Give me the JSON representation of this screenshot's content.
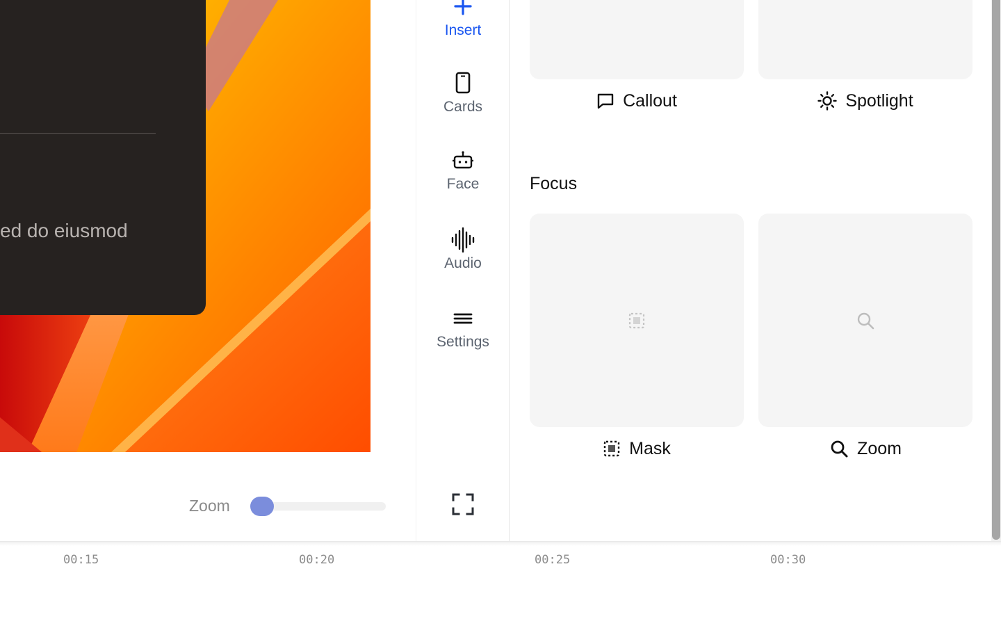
{
  "preview": {
    "card_text": "ed do eiusmod",
    "zoom_label": "Zoom",
    "zoom_level": 0
  },
  "rail": {
    "items": [
      {
        "label": "Insert",
        "icon": "plus-icon",
        "active": true
      },
      {
        "label": "Cards",
        "icon": "phone-card-icon"
      },
      {
        "label": "Face",
        "icon": "robot-face-icon"
      },
      {
        "label": "Audio",
        "icon": "waveform-icon"
      },
      {
        "label": "Settings",
        "icon": "menu-lines-icon"
      }
    ],
    "fullscreen_icon": "fullscreen-icon",
    "active_color": "#1a56f0"
  },
  "panel": {
    "top_tiles": [
      {
        "label": "Callout",
        "icon": "speech-bubble-icon"
      },
      {
        "label": "Spotlight",
        "icon": "sun-icon"
      }
    ],
    "focus_section": {
      "title": "Focus",
      "tiles": [
        {
          "label": "Mask",
          "icon": "mask-selection-icon"
        },
        {
          "label": "Zoom",
          "icon": "magnifier-icon"
        }
      ]
    }
  },
  "timeline": {
    "ticks": [
      "00:15",
      "00:20",
      "00:25",
      "00:30"
    ]
  },
  "colors": {
    "slider_thumb": "#7b8ddc",
    "tile_bg": "#f5f5f5",
    "dark_card": "#262220"
  }
}
